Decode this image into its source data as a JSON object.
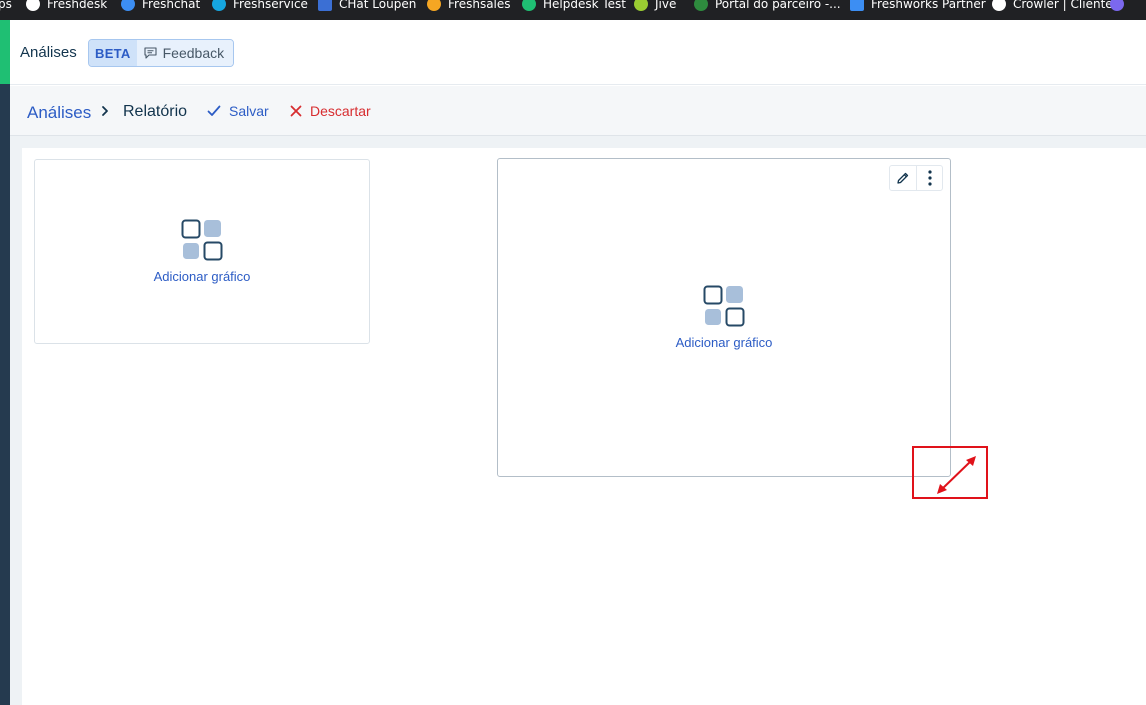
{
  "bookmarks": [
    {
      "label": "ps",
      "color": ""
    },
    {
      "label": "Freshdesk",
      "color": "#ffffff"
    },
    {
      "label": "Freshchat",
      "color": "#3c8ef3"
    },
    {
      "label": "Freshservice",
      "color": "#16a6e0"
    },
    {
      "label": "CHat Loupen",
      "color": "#3b6fd4"
    },
    {
      "label": "Freshsales",
      "color": "#f5a623"
    },
    {
      "label": "Helpdesk Test",
      "color": "#1fbf73"
    },
    {
      "label": "Jive",
      "color": "#9acd32"
    },
    {
      "label": "Portal do parceiro -...",
      "color": "#2e8b3e"
    },
    {
      "label": "Freshworks Partner",
      "color": "#3c8ef3"
    },
    {
      "label": "Crowler | Clientes",
      "color": "#ffffff"
    },
    {
      "label": "",
      "color": "#7b68ee"
    }
  ],
  "header": {
    "title": "Análises",
    "beta_label": "BETA",
    "feedback_label": "Feedback"
  },
  "breadcrumb": {
    "root": "Análises",
    "current": "Relatório",
    "save_label": "Salvar",
    "discard_label": "Descartar"
  },
  "widgets": [
    {
      "add_label": "Adicionar gráfico"
    },
    {
      "add_label": "Adicionar gráfico"
    }
  ],
  "colors": {
    "accent": "#2c5cc5",
    "danger": "#d72d30",
    "sidebar": "#253a4f",
    "sidebar_accent": "#1fbf73",
    "annotation": "#e0121a"
  }
}
